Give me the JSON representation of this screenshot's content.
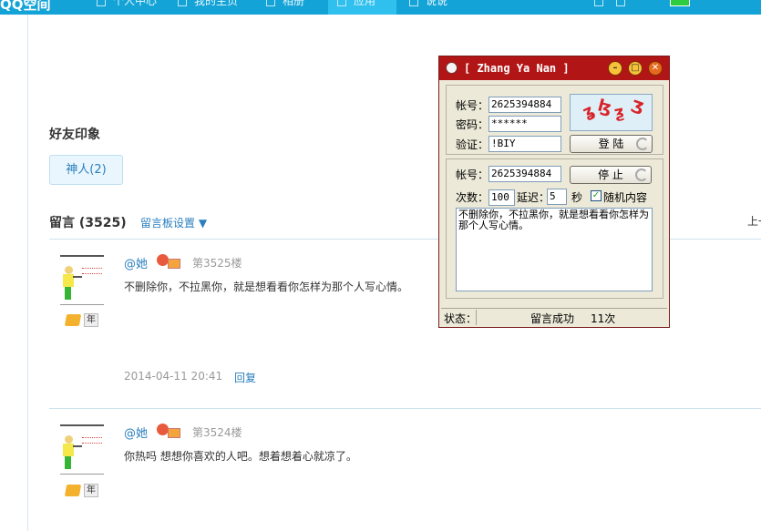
{
  "topbar": {
    "logo": "QQ空间",
    "nav": [
      "个人中心",
      "我的主页",
      "相册",
      "应用",
      "说说"
    ]
  },
  "impression": {
    "title": "好友印象",
    "tag": "神人(2)"
  },
  "board": {
    "title": "留言 (3525)",
    "settings": "留言板设置 ▼",
    "page_up": "上一页"
  },
  "messages": [
    {
      "user": "@她",
      "floor": "第3525楼",
      "text": "不删除你，不拉黑你，就是想看看你怎样为那个人写心情。",
      "date": "2014-04-11 20:41",
      "reply": "回复",
      "badge_year": "年"
    },
    {
      "user": "@她",
      "floor": "第3524楼",
      "text": "你热吗 想想你喜欢的人吧。想着想着心就凉了。",
      "badge_year": "年"
    }
  ],
  "popup": {
    "title": "[ Zhang Ya Nan ]",
    "account_label": "帐号：",
    "account_value": "2625394884",
    "password_label": "密码：",
    "password_value": "******",
    "verify_label": "验证：",
    "verify_value": "!BIY",
    "login_button": "登 陆",
    "account2_label": "帐号：",
    "account2_value": "2625394884",
    "stop_button": "停 止",
    "count_label": "次数：",
    "count_value": "100",
    "delay_label": "延迟：",
    "delay_value": "5",
    "seconds_label": "秒",
    "random_label": "随机内容",
    "random_checked": true,
    "content": "不删除你，不拉黑你，就是想看看你怎样为那个人写心情。",
    "status_label": "状态：",
    "status_text": "留言成功",
    "status_count": "11次",
    "title_color": "#b21515"
  }
}
